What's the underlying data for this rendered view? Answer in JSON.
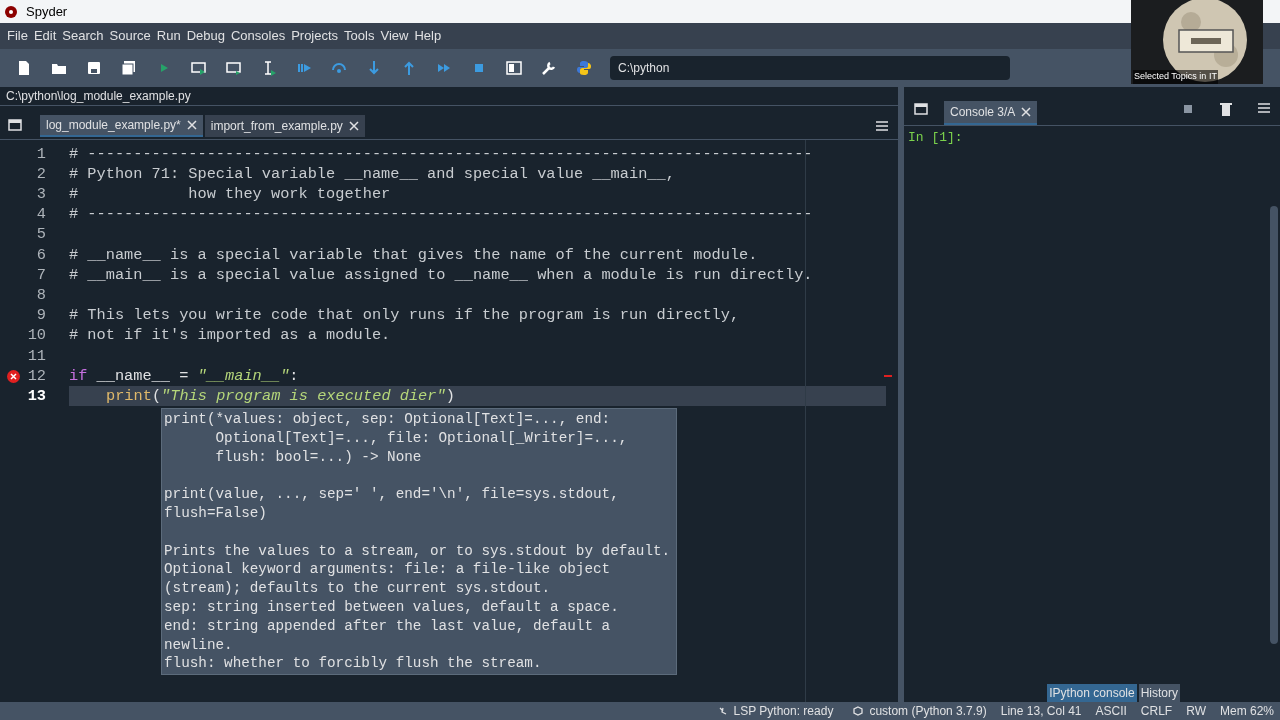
{
  "window": {
    "title": "Spyder"
  },
  "menu": [
    "File",
    "Edit",
    "Search",
    "Source",
    "Run",
    "Debug",
    "Consoles",
    "Projects",
    "Tools",
    "View",
    "Help"
  ],
  "working_directory": "C:\\python",
  "webcam": {
    "kind": "picture",
    "caption": "Selected Topics in IT"
  },
  "editor": {
    "path": "C:\\python\\log_module_example.py",
    "tabs": [
      {
        "label": "log_module_example.py*",
        "selected": true
      },
      {
        "label": "import_from_example.py",
        "selected": false
      }
    ],
    "lines": [
      {
        "number": "1",
        "current": false,
        "error": false,
        "tokens": [
          {
            "kind": "comment",
            "text": "# -------------------------------------------------------------------------------"
          }
        ]
      },
      {
        "number": "2",
        "current": false,
        "error": false,
        "tokens": [
          {
            "kind": "comment",
            "text": "# Python 71: Special variable __name__ and special value __main__,"
          }
        ]
      },
      {
        "number": "3",
        "current": false,
        "error": false,
        "tokens": [
          {
            "kind": "comment",
            "text": "#            how they work together"
          }
        ]
      },
      {
        "number": "4",
        "current": false,
        "error": false,
        "tokens": [
          {
            "kind": "comment",
            "text": "# -------------------------------------------------------------------------------"
          }
        ]
      },
      {
        "number": "5",
        "current": false,
        "error": false
      },
      {
        "number": "6",
        "current": false,
        "error": false,
        "tokens": [
          {
            "kind": "comment",
            "text": "# __name__ is a special variable that gives the name of the current module."
          }
        ]
      },
      {
        "number": "7",
        "current": false,
        "error": false,
        "tokens": [
          {
            "kind": "comment",
            "text": "# __main__ is a special value assigned to __name__ when a module is run directly."
          }
        ]
      },
      {
        "number": "8",
        "current": false,
        "error": false
      },
      {
        "number": "9",
        "current": false,
        "error": false,
        "tokens": [
          {
            "kind": "comment",
            "text": "# This lets you write code that only runs if the program is run directly,"
          }
        ]
      },
      {
        "number": "10",
        "current": false,
        "error": false,
        "tokens": [
          {
            "kind": "comment",
            "text": "# not if it's imported as a module."
          }
        ]
      },
      {
        "number": "11",
        "current": false,
        "error": false
      },
      {
        "number": "12",
        "current": false,
        "error": true,
        "tokens": [
          {
            "kind": "keyword",
            "text": "if"
          },
          {
            "kind": "plain",
            "text": " __name__ = "
          },
          {
            "kind": "string",
            "text": "\"__main__\""
          },
          {
            "kind": "plain",
            "text": ":"
          }
        ]
      },
      {
        "number": "13",
        "current": true,
        "error": false,
        "indented": true,
        "tokens": [
          {
            "kind": "builtin",
            "text": "print"
          },
          {
            "kind": "plain",
            "text": "("
          },
          {
            "kind": "string",
            "text": "\"This program is executed dier\""
          },
          {
            "kind": "plain",
            "text": ")"
          }
        ]
      }
    ],
    "calltip": {
      "signature": [
        "print(*values: object, sep: Optional[Text]=..., end:",
        "      Optional[Text]=..., file: Optional[_Writer]=...,",
        "      flush: bool=...) -> None"
      ],
      "usage": [
        "print(value, ..., sep=' ', end='\\n', file=sys.stdout,",
        "flush=False)"
      ],
      "doc": [
        "Prints the values to a stream, or to sys.stdout by default.",
        "Optional keyword arguments: file: a file-like object",
        "(stream); defaults to the current sys.stdout.",
        "sep: string inserted between values, default a space.",
        "end: string appended after the last value, default a",
        "newline.",
        "flush: whether to forcibly flush the stream."
      ]
    }
  },
  "console": {
    "tabs": [
      {
        "label": "Console 3/A",
        "selected": true
      }
    ],
    "prompt": "In [1]:",
    "pane_tabs": [
      {
        "label": "IPython console",
        "selected": true
      },
      {
        "label": "History",
        "selected": false
      }
    ]
  },
  "status_bar": [
    "LSP Python: ready",
    "custom (Python 3.7.9)",
    "Line 13, Col 41",
    "ASCII",
    "CRLF",
    "RW",
    "Mem 62%"
  ]
}
